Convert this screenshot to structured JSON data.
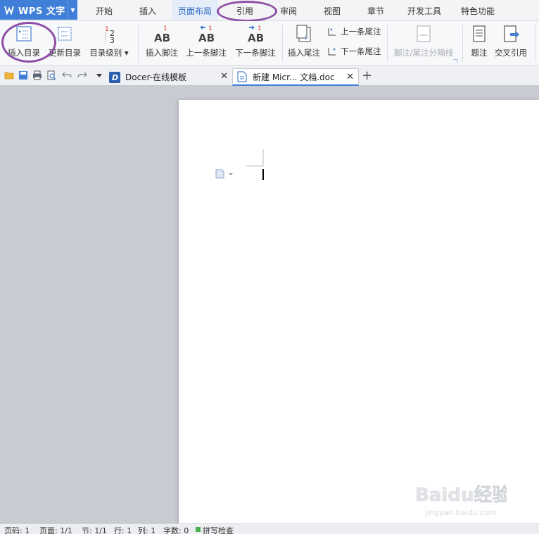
{
  "app": {
    "title": "WPS 文字"
  },
  "menu": {
    "tabs": [
      "开始",
      "插入",
      "页面布局",
      "引用",
      "审阅",
      "视图",
      "章节",
      "开发工具",
      "特色功能"
    ]
  },
  "ribbon": {
    "insert_toc": "插入目录",
    "update_toc": "更新目录",
    "toc_level": "目录级别",
    "insert_footnote": "插入脚注",
    "prev_footnote": "上一条脚注",
    "next_footnote": "下一条脚注",
    "insert_endnote": "插入尾注",
    "prev_endnote": "上一条尾注",
    "next_endnote": "下一条尾注",
    "separator_line": "脚注/尾注分隔线",
    "caption": "题注",
    "cross_ref": "交叉引用",
    "footnote_num": "1"
  },
  "doc_tabs": [
    {
      "label": "Docer-在线模板"
    },
    {
      "label": "新建 Micr... 文档.doc"
    }
  ],
  "status": {
    "page": "页码: 1",
    "pages": "页面: 1/1",
    "section": "节: 1/1",
    "row": "行: 1",
    "col": "列: 1",
    "words": "字数: 0",
    "spell": "拼写检查"
  },
  "watermark": {
    "brand": "Baidu经验",
    "url": "jingyan.baidu.com"
  },
  "colors": {
    "accent": "#3f7fd8",
    "annotation": "#8e4fa6",
    "footnote_red": "#e0302a"
  }
}
